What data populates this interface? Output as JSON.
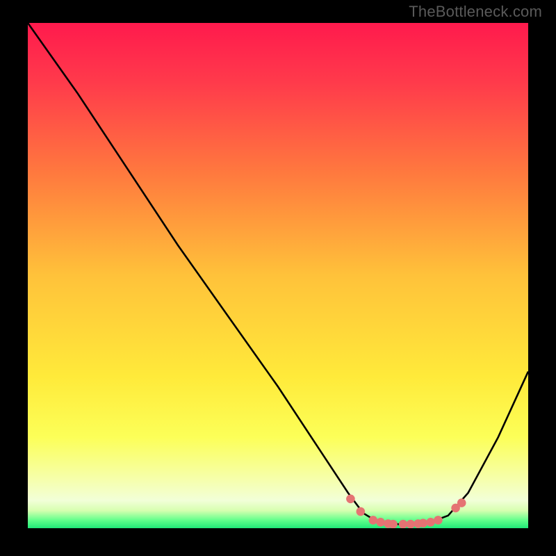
{
  "attribution": "TheBottleneck.com",
  "chart_data": {
    "type": "line",
    "title": "",
    "xlabel": "",
    "ylabel": "",
    "xlim": [
      0,
      100
    ],
    "ylim": [
      0,
      100
    ],
    "curve": {
      "name": "bottleneck-curve",
      "color": "#000000",
      "points": [
        {
          "x": 0,
          "y": 100
        },
        {
          "x": 10,
          "y": 86
        },
        {
          "x": 20,
          "y": 71
        },
        {
          "x": 30,
          "y": 56
        },
        {
          "x": 40,
          "y": 42
        },
        {
          "x": 50,
          "y": 28
        },
        {
          "x": 58,
          "y": 16
        },
        {
          "x": 64,
          "y": 7
        },
        {
          "x": 67,
          "y": 3
        },
        {
          "x": 70,
          "y": 1.2
        },
        {
          "x": 75,
          "y": 0.7
        },
        {
          "x": 80,
          "y": 1.0
        },
        {
          "x": 84,
          "y": 2.5
        },
        {
          "x": 88,
          "y": 7
        },
        {
          "x": 94,
          "y": 18
        },
        {
          "x": 100,
          "y": 31
        }
      ]
    },
    "highlight_dots": {
      "name": "optimal-range-markers",
      "color": "#e57373",
      "points": [
        {
          "x": 64.5,
          "y": 5.8
        },
        {
          "x": 66.5,
          "y": 3.3
        },
        {
          "x": 69.0,
          "y": 1.6
        },
        {
          "x": 70.5,
          "y": 1.2
        },
        {
          "x": 72.0,
          "y": 0.9
        },
        {
          "x": 73.0,
          "y": 0.8
        },
        {
          "x": 75.0,
          "y": 0.8
        },
        {
          "x": 76.5,
          "y": 0.8
        },
        {
          "x": 78.0,
          "y": 0.9
        },
        {
          "x": 79.0,
          "y": 1.0
        },
        {
          "x": 80.5,
          "y": 1.2
        },
        {
          "x": 82.0,
          "y": 1.6
        },
        {
          "x": 85.5,
          "y": 4.0
        },
        {
          "x": 86.7,
          "y": 5.0
        }
      ]
    },
    "gradient_stops": [
      {
        "offset": 0.0,
        "color": "#ff1a4d"
      },
      {
        "offset": 0.12,
        "color": "#ff3b4b"
      },
      {
        "offset": 0.3,
        "color": "#ff7a3e"
      },
      {
        "offset": 0.5,
        "color": "#ffc23a"
      },
      {
        "offset": 0.7,
        "color": "#ffea3a"
      },
      {
        "offset": 0.82,
        "color": "#fcff58"
      },
      {
        "offset": 0.9,
        "color": "#f6ffa8"
      },
      {
        "offset": 0.945,
        "color": "#f2ffd8"
      },
      {
        "offset": 0.965,
        "color": "#d7ffb0"
      },
      {
        "offset": 0.985,
        "color": "#5dff8a"
      },
      {
        "offset": 1.0,
        "color": "#20e878"
      }
    ]
  }
}
